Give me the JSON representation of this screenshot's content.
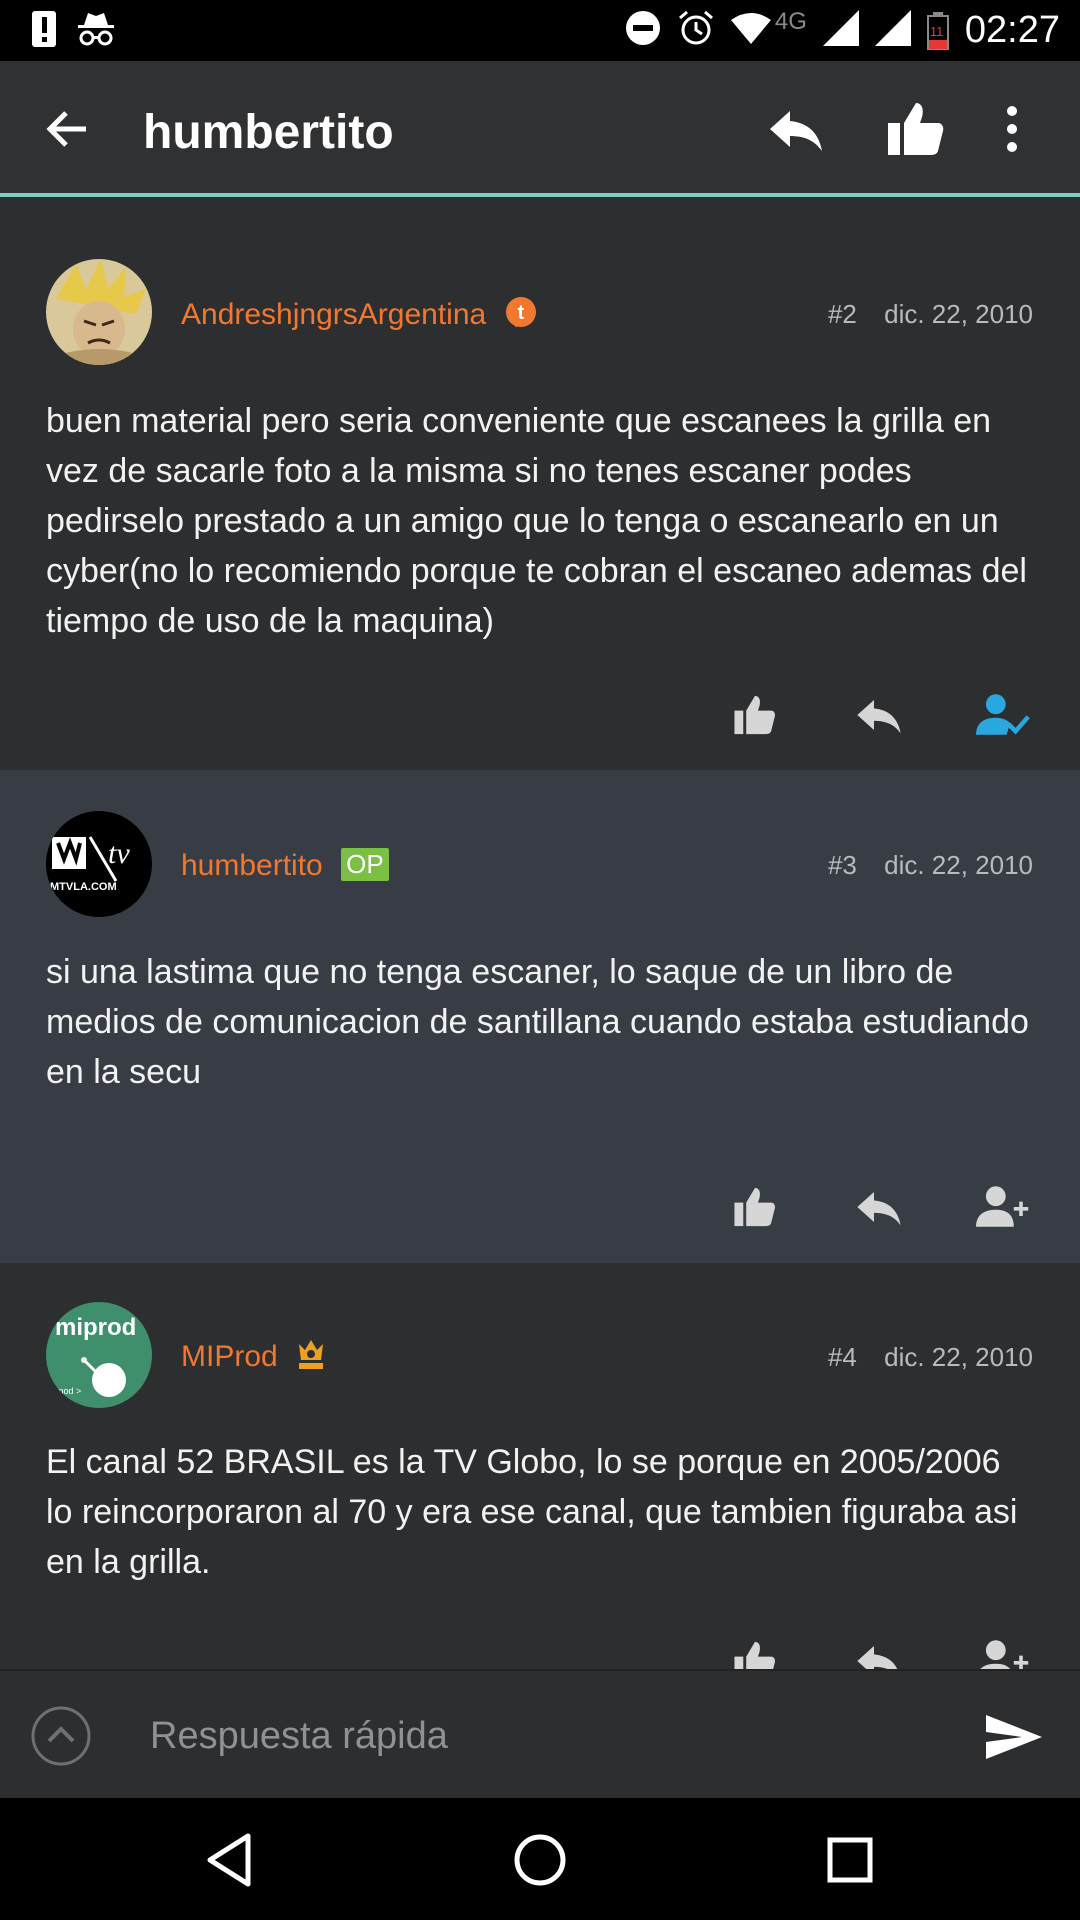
{
  "status_bar": {
    "time": "02:27",
    "network": "4G",
    "battery_level": "11",
    "icons": [
      "alert-icon",
      "incognito-icon",
      "do-not-disturb-icon",
      "alarm-icon",
      "wifi-icon",
      "signal-icon",
      "battery-icon"
    ]
  },
  "app_bar": {
    "title": "humbertito",
    "accent_color": "#7fd0c9"
  },
  "posts": [
    {
      "author": "AndreshjngrsArgentina",
      "number": "#2",
      "date": "dic. 22, 2010",
      "body": "buen material pero seria conveniente que escanees la grilla en vez de sacarle foto a la misma si no tenes escaner podes pedirselo prestado a un amigo que lo tenga o escanearlo en un cyber(no lo recomiendo porque te cobran el escaneo ademas del tiempo de uso de la maquina)",
      "badge_icon": "tapatalk-badge-icon",
      "follow_state": "followed"
    },
    {
      "author": "humbertito",
      "badge": "OP",
      "number": "#3",
      "date": "dic. 22, 2010",
      "body": "si una lastima que no tenga escaner, lo saque de un libro de medios de comunicacion de santillana cuando estaba estudiando en la secu",
      "avatar_text": "MTVLA.COM",
      "follow_state": "not-followed"
    },
    {
      "author": "MIProd",
      "number": "#4",
      "date": "dic. 22, 2010",
      "body": "El canal 52 BRASIL es la TV Globo, lo se porque en 2005/2006 lo reincorporaron al 70 y era ese canal, que tambien figuraba asi en la grilla.",
      "badge_icon": "moderator-crown-icon",
      "avatar_text": "miprod",
      "follow_state": "not-followed"
    }
  ],
  "colors": {
    "author": "#f0782f",
    "op_badge": "#7bc043",
    "followed": "#29a8e0"
  },
  "reply_bar": {
    "placeholder": "Respuesta rápida"
  }
}
